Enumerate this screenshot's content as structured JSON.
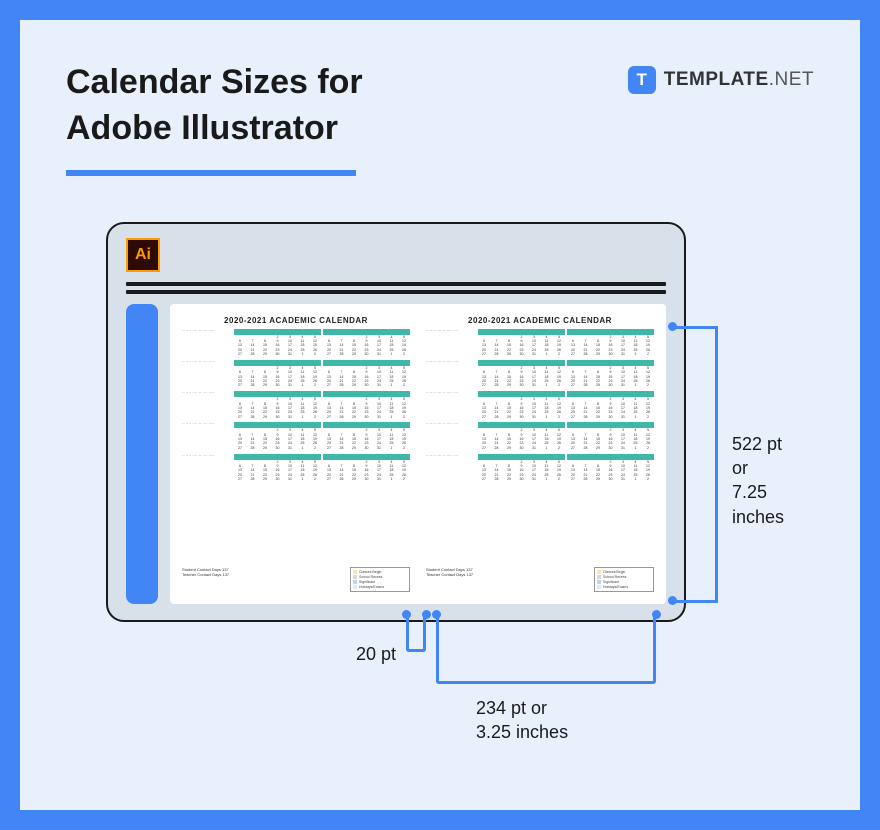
{
  "title_line1": "Calendar Sizes for",
  "title_line2": "Adobe Illustrator",
  "brand": {
    "badge": "T",
    "name": "TEMPLATE",
    "suffix": ".NET"
  },
  "ai_icon_label": "Ai",
  "calendar": {
    "page_title": "2020-2021 ACADEMIC CALENDAR",
    "legend_left": [
      "Student Contact Days   137",
      "Teacher Contact Days   137"
    ],
    "legend_items": [
      {
        "color": "#f5e7b0",
        "label": "Classes Begin"
      },
      {
        "color": "#d8d8d8",
        "label": "School Recess"
      },
      {
        "color": "#b9d8f0",
        "label": "Significant"
      },
      {
        "color": "#e8e8e8",
        "label": "Holidays/Exams"
      }
    ]
  },
  "dimensions": {
    "height_label_l1": "522 pt or",
    "height_label_l2": "7.25 inches",
    "gap_label": "20 pt",
    "width_label_l1": "234 pt or",
    "width_label_l2": "3.25 inches"
  }
}
